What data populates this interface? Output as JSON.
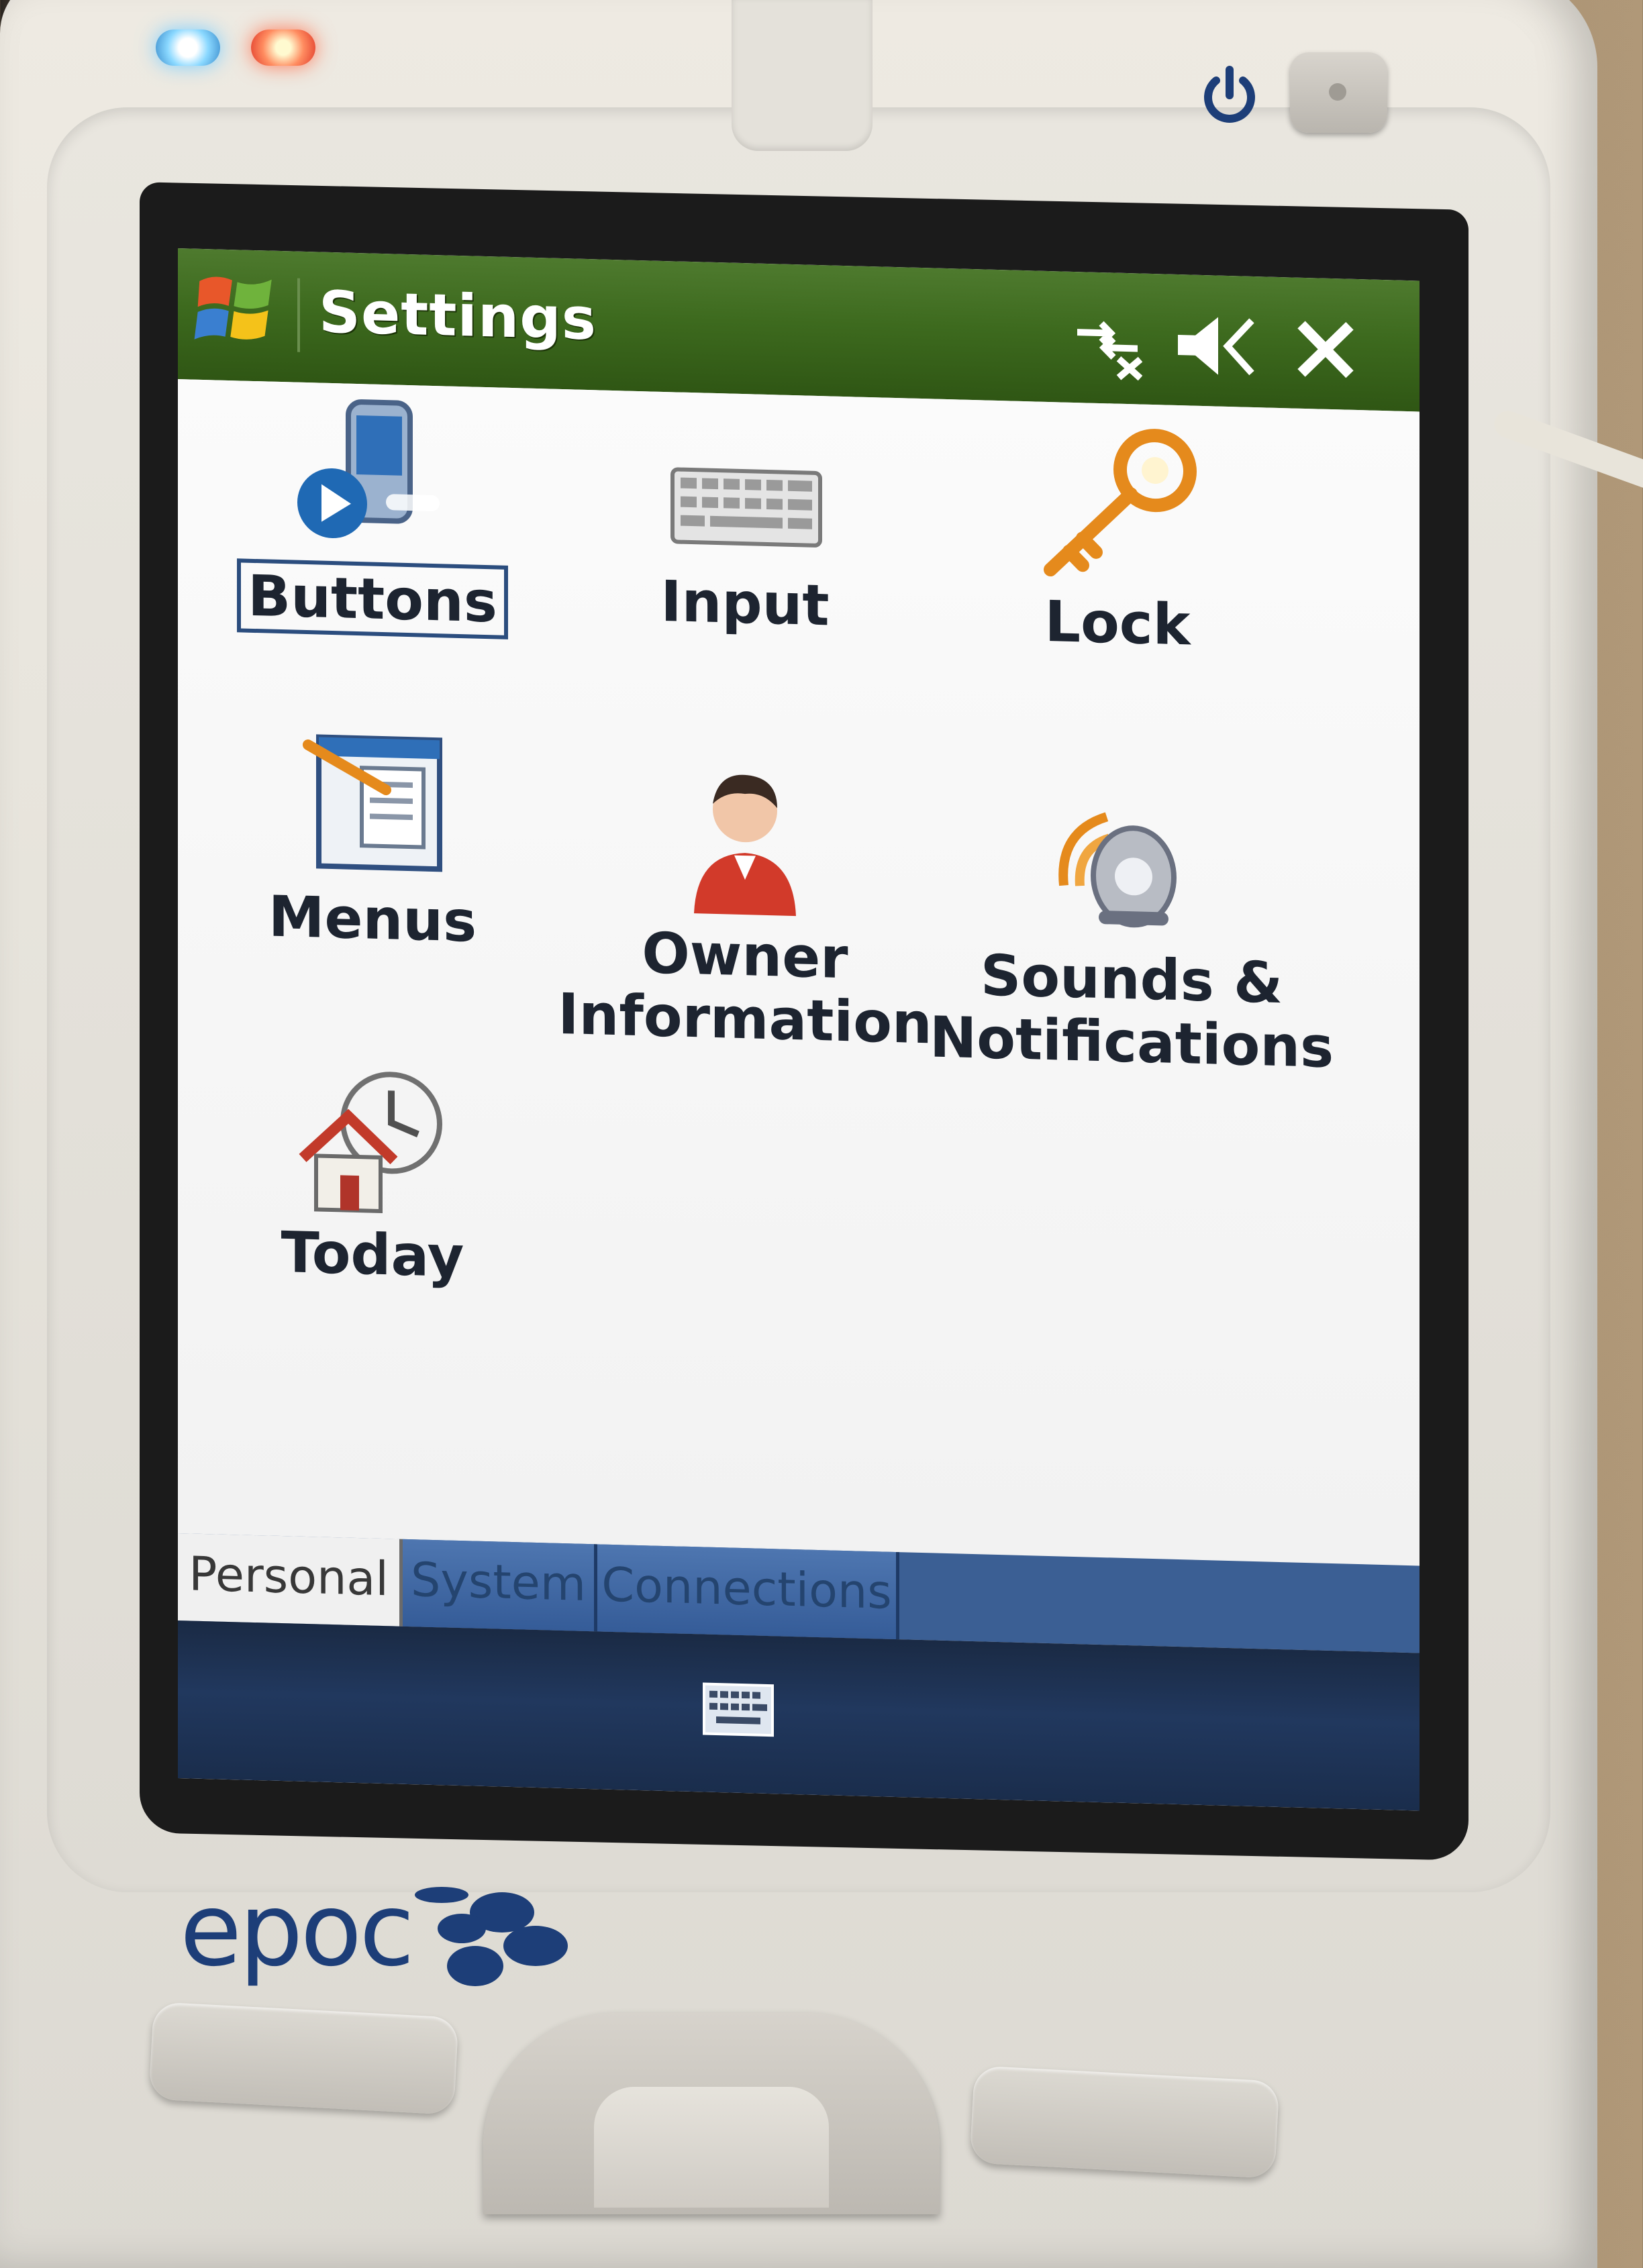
{
  "device": {
    "brand": "epoc",
    "indicators": [
      "blue-led",
      "red-led"
    ],
    "power_icon": "power-icon"
  },
  "titlebar": {
    "title": "Settings",
    "start_icon": "windows-flag-icon",
    "status_icons": [
      "connectivity-icon",
      "volume-muted-icon"
    ],
    "close_icon": "close-icon"
  },
  "settings_items": [
    {
      "label": "Buttons",
      "icon": "buttons-icon",
      "selected": true
    },
    {
      "label": "Input",
      "icon": "keyboard-icon",
      "selected": false
    },
    {
      "label": "Lock",
      "icon": "key-icon",
      "selected": false
    },
    {
      "label": "Menus",
      "icon": "menus-icon",
      "selected": false
    },
    {
      "label": "Owner\nInformation",
      "icon": "owner-icon",
      "selected": false
    },
    {
      "label": "Sounds &\nNotifications",
      "icon": "sounds-icon",
      "selected": false
    },
    {
      "label": "Today",
      "icon": "today-icon",
      "selected": false
    }
  ],
  "tabs": [
    {
      "label": "Personal",
      "active": true
    },
    {
      "label": "System",
      "active": false
    },
    {
      "label": "Connections",
      "active": false
    }
  ],
  "menubar": {
    "input_panel_icon": "keyboard-icon"
  },
  "colors": {
    "titlebar": "#3d6a1e",
    "tab_active": "#f0f0f0",
    "tab_inactive": "#3b5f94",
    "menubar": "#1a2a44"
  }
}
